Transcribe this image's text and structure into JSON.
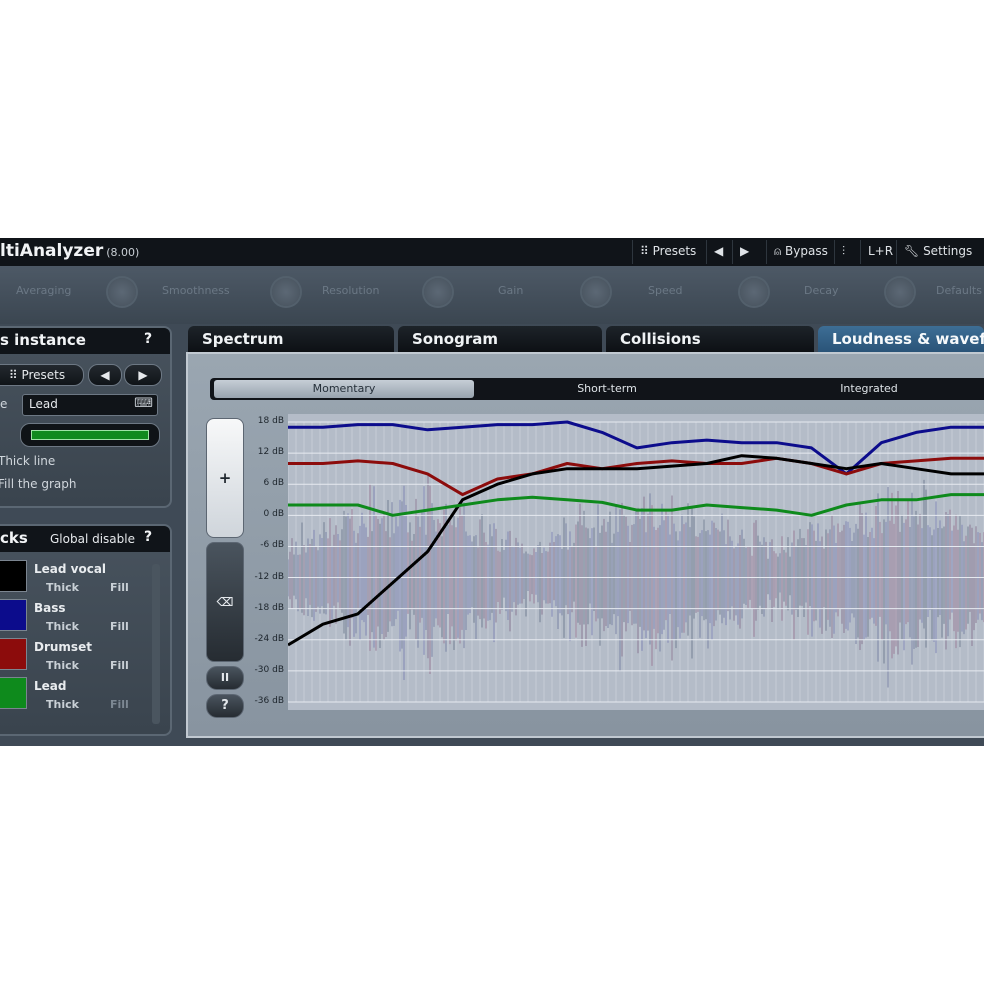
{
  "title_bar": {
    "app_name": "ltiAnalyzer",
    "version": "(8.00)",
    "presets_label": "Presets",
    "bypass_label": "Bypass",
    "channel_label": "L+R",
    "settings_label": "Settings"
  },
  "params": [
    "Averaging",
    "Smoothness",
    "Resolution",
    "Gain",
    "Speed",
    "Decay",
    "Defaults"
  ],
  "instance_panel": {
    "title": "s instance",
    "help": "?",
    "presets_label": "Presets",
    "name_label": "e",
    "name_value": "Lead",
    "color_label": "",
    "thick_line_label": "Thick line",
    "fill_graph_label": "Fill the graph",
    "color_hex": "#118a1e"
  },
  "tracks_panel": {
    "title": "cks",
    "global_disable_label": "Global disable",
    "help": "?",
    "tracks": [
      {
        "name": "Lead vocal",
        "color": "#000000",
        "thick": "Thick",
        "fill": "Fill"
      },
      {
        "name": "Bass",
        "color": "#0c0c8c",
        "thick": "Thick",
        "fill": "Fill"
      },
      {
        "name": "Drumset",
        "color": "#8c0c0c",
        "thick": "Thick",
        "fill": "Fill"
      },
      {
        "name": "Lead",
        "color": "#0e8a1c",
        "thick": "Thick",
        "fill": "Fill"
      }
    ]
  },
  "tabs": [
    {
      "label": "Spectrum",
      "active": false
    },
    {
      "label": "Sonogram",
      "active": false
    },
    {
      "label": "Collisions",
      "active": false
    },
    {
      "label": "Loudness & wavefo",
      "active": true
    }
  ],
  "modes": [
    {
      "label": "Momentary",
      "active": true
    },
    {
      "label": "Short-term",
      "active": false
    },
    {
      "label": "Integrated",
      "active": false
    }
  ],
  "side_buttons": {
    "zoom_in": "+",
    "clear": "⌫",
    "pause": "II",
    "help": "?"
  },
  "chart_data": {
    "type": "line",
    "xlabel": "",
    "ylabel": "",
    "yticks": [
      "18 dB",
      "12 dB",
      "6 dB",
      "0 dB",
      "-6 dB",
      "-12 dB",
      "-18 dB",
      "-24 dB",
      "-30 dB",
      "-36 dB"
    ],
    "ylim": [
      -36,
      18
    ],
    "x": [
      0,
      5,
      10,
      15,
      20,
      25,
      30,
      35,
      40,
      45,
      50,
      55,
      60,
      65,
      70,
      75,
      80,
      85,
      90,
      95,
      100
    ],
    "series": [
      {
        "color": "#0c0c8c",
        "values": [
          17,
          17,
          17.5,
          17.5,
          16.5,
          17,
          17.5,
          17.5,
          18,
          16,
          13,
          14,
          14.5,
          14,
          14,
          13,
          8,
          14,
          16,
          17,
          17
        ]
      },
      {
        "color": "#8c0c0c",
        "values": [
          10,
          10,
          10.5,
          10,
          8,
          4,
          7,
          8,
          10,
          9,
          10,
          10.5,
          10,
          10,
          11,
          10,
          8,
          10,
          10.5,
          11,
          11
        ]
      },
      {
        "color": "#000000",
        "values": [
          -25,
          -21,
          -19,
          -13,
          -7,
          3,
          6,
          8,
          9,
          9,
          9,
          9.5,
          10,
          11.5,
          11,
          10,
          9,
          10,
          9,
          8,
          8
        ]
      },
      {
        "color": "#0e8a1c",
        "values": [
          2,
          2,
          2,
          0,
          1,
          2,
          3,
          3.5,
          3,
          2.5,
          1,
          1,
          2,
          1.5,
          1,
          0,
          2,
          3,
          3,
          4,
          4
        ]
      }
    ]
  }
}
